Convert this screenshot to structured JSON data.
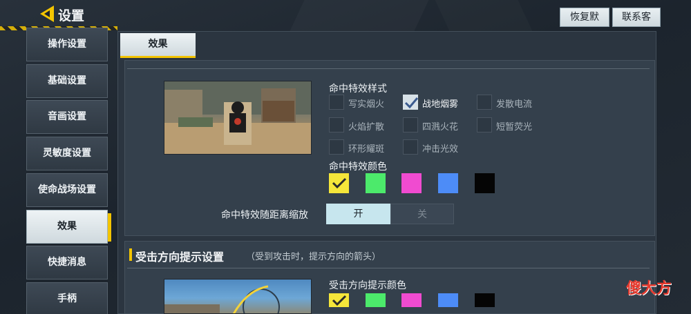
{
  "header": {
    "title": "设置",
    "restore_default": "恢复默认",
    "contact_service": "联系客服"
  },
  "sidebar": {
    "items": [
      {
        "label": "操作设置"
      },
      {
        "label": "基础设置"
      },
      {
        "label": "音画设置"
      },
      {
        "label": "灵敏度设置"
      },
      {
        "label": "使命战场设置"
      },
      {
        "label": "效果",
        "active": true
      },
      {
        "label": "快捷消息"
      },
      {
        "label": "手柄"
      }
    ]
  },
  "tabs": {
    "effect": "效果"
  },
  "hit_effect": {
    "style_title": "命中特效样式",
    "styles": [
      {
        "label": "写实烟火",
        "checked": false
      },
      {
        "label": "战地烟雾",
        "checked": true
      },
      {
        "label": "发散电流",
        "checked": false
      },
      {
        "label": "火焰扩散",
        "checked": false
      },
      {
        "label": "四溅火花",
        "checked": false
      },
      {
        "label": "短暂荧光",
        "checked": false
      },
      {
        "label": "环形耀斑",
        "checked": false
      },
      {
        "label": "冲击光效",
        "checked": false
      }
    ],
    "color_title": "命中特效颜色",
    "colors": [
      {
        "name": "yellow",
        "hex": "#f5e63a",
        "selected": true
      },
      {
        "name": "green",
        "hex": "#4cea6b",
        "selected": false
      },
      {
        "name": "pink",
        "hex": "#f04bd0",
        "selected": false
      },
      {
        "name": "blue",
        "hex": "#4d8cf7",
        "selected": false
      },
      {
        "name": "black",
        "hex": "#050505",
        "selected": false
      }
    ],
    "distance_scale_label": "命中特效随距离缩放",
    "toggle_on": "开",
    "toggle_off": "关",
    "toggle_state": "on"
  },
  "hit_direction": {
    "title": "受击方向提示设置",
    "note": "（受到攻击时，提示方向的箭头）",
    "color_title": "受击方向提示颜色",
    "colors": [
      {
        "name": "yellow",
        "hex": "#f5e63a",
        "selected": true
      },
      {
        "name": "green",
        "hex": "#4cea6b",
        "selected": false
      },
      {
        "name": "pink",
        "hex": "#f04bd0",
        "selected": false
      },
      {
        "name": "blue",
        "hex": "#4d8cf7",
        "selected": false
      },
      {
        "name": "black",
        "hex": "#050505",
        "selected": false
      }
    ]
  },
  "watermark": "傻大方",
  "colors": {
    "accent": "#f3c400",
    "panel": "#34404c",
    "active_tab": "#e6edf0"
  }
}
